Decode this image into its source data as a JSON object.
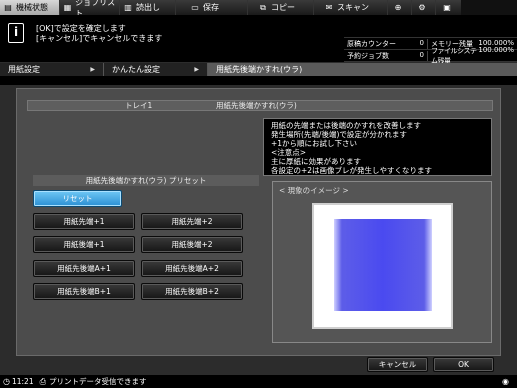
{
  "top_tabs": [
    {
      "label": "機械状態",
      "icon": "machine-status-icon",
      "glyph": "▤",
      "active": true
    },
    {
      "label": "ジョブリスト",
      "icon": "job-list-icon",
      "glyph": "▦",
      "active": false
    },
    {
      "label": "読出し",
      "icon": "retrieve-icon",
      "glyph": "▥",
      "active": false
    },
    {
      "label": "保存",
      "icon": "save-icon",
      "glyph": "▭",
      "active": false
    },
    {
      "label": "コピー",
      "icon": "copy-icon",
      "glyph": "⧉",
      "active": false
    },
    {
      "label": "スキャン",
      "icon": "scan-icon",
      "glyph": "✉",
      "active": false
    }
  ],
  "top_icons": {
    "globe": "globe-icon",
    "settings": "settings-icon",
    "user": "user-icon"
  },
  "message": {
    "line1": "[OK]で設定を確定します",
    "line2": "[キャンセル]でキャンセルできます"
  },
  "stats": {
    "row1": {
      "label1": "原稿カウンター",
      "value1": "0",
      "label2": "メモリー残量",
      "value2": "100.000%"
    },
    "row2": {
      "label1": "予約ジョブ数",
      "value1": "0",
      "label2": "ファイルシステム残量",
      "value2": "100.000%"
    }
  },
  "breadcrumb": [
    "用紙設定",
    "かんたん設定",
    "用紙先後端かすれ(ウラ)"
  ],
  "panel": {
    "tray": "トレイ1",
    "title": "用紙先後端かすれ(ウラ)",
    "preset_label": "用紙先後端かすれ(ウラ) プリセット",
    "reset": "リセット",
    "buttons_left": [
      "用紙先端+1",
      "用紙後端+1",
      "用紙先後端A+1",
      "用紙先後端B+1"
    ],
    "buttons_right": [
      "用紙先端+2",
      "用紙後端+2",
      "用紙先後端A+2",
      "用紙先後端B+2"
    ],
    "description": [
      "用紙の先端または後端のかすれを改善します",
      "発生場所(先端/後端)で設定が分かれます",
      "+1から順にお試し下さい",
      "<注意点>",
      "主に厚紙に効果があります",
      "各設定の+2は画像ブレが発生しやすくなります"
    ],
    "image_title": "< 現象のイメージ >",
    "image_color": "#4a4af0"
  },
  "bottom": {
    "cancel": "キャンセル",
    "ok": "OK"
  },
  "status": {
    "time": "11:21",
    "message": "プリントデータ受信できます"
  }
}
